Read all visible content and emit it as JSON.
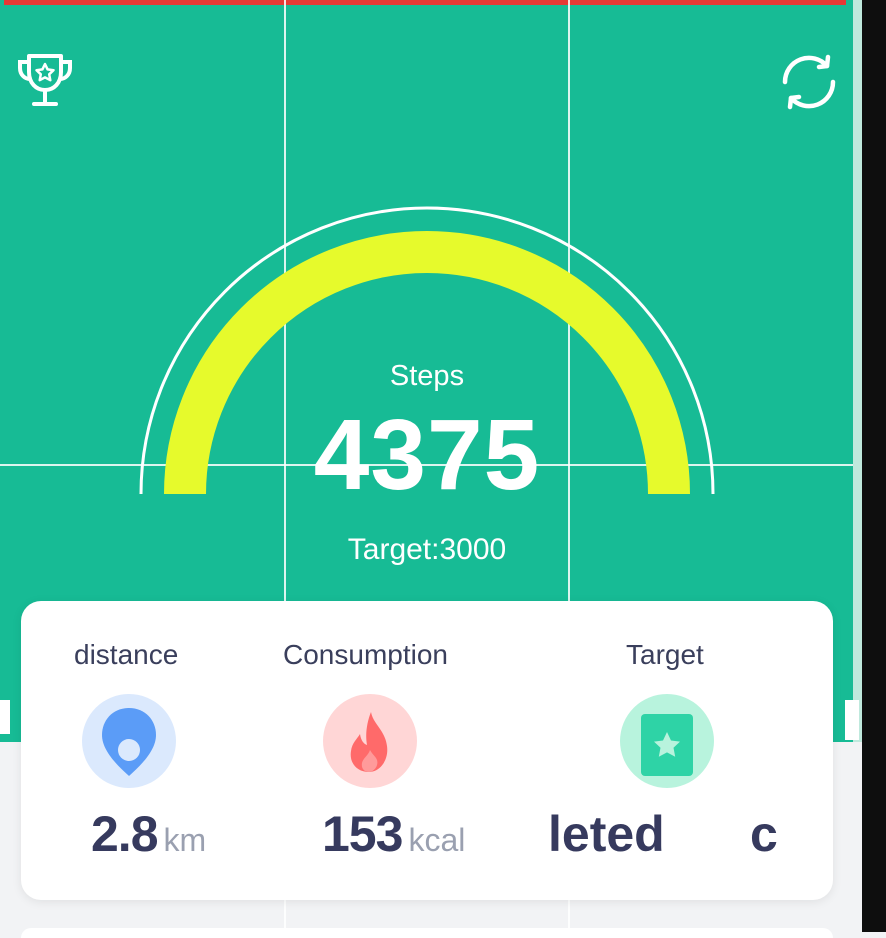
{
  "header": {
    "trophy_icon": "trophy-star-icon",
    "sync_icon": "sync-icon"
  },
  "gauge": {
    "steps_label": "Steps",
    "steps_value": "4375",
    "target_label": "Target:3000",
    "progress_fraction": 1.0,
    "arc_color": "#e6fa2c",
    "background_color": "#17bb95"
  },
  "stats": {
    "distance": {
      "title": "distance",
      "value": "2.8",
      "unit": "km",
      "icon": "location-pin-icon",
      "color": "#5b9cf7"
    },
    "consumption": {
      "title": "Consumption",
      "value": "153",
      "unit": "kcal",
      "icon": "flame-icon",
      "color": "#ff6a6a"
    },
    "target": {
      "title": "Target",
      "value_partial": "leted",
      "icon": "star-badge-icon",
      "color": "#2ed3a6"
    },
    "next_partial": "c"
  }
}
